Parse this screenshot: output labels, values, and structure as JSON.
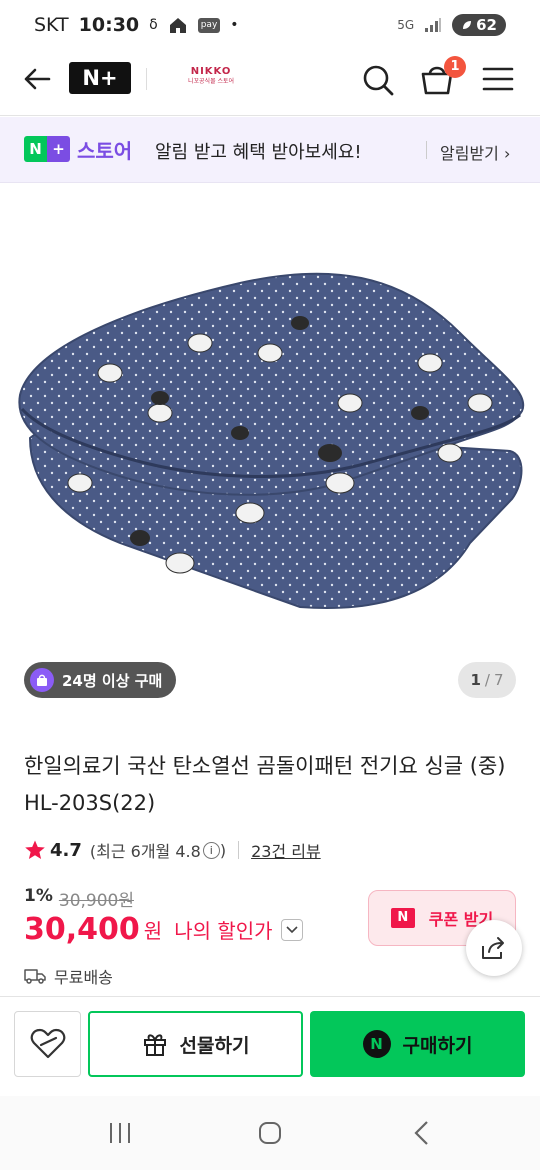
{
  "status_bar": {
    "carrier": "SKT",
    "time": "10:30",
    "pay_label": "pay",
    "network": "5G",
    "battery": "62"
  },
  "header": {
    "logo": "N+",
    "seller_logo_main": "NIKKO",
    "seller_logo_sub": "니꼬공식몰 스토어",
    "cart_count": "1"
  },
  "banner": {
    "logo_n": "N",
    "logo_plus": "+",
    "store_label": "스토어",
    "message": "알림 받고 혜택 받아보세요!",
    "action": "알림받기"
  },
  "gallery": {
    "purchase_badge": "24명 이상 구매",
    "page_current": "1",
    "page_sep": "/",
    "page_total": "7"
  },
  "product": {
    "title": "한일의료기 국산 탄소열선 곰돌이패턴 전기요 싱글 (중) HL-203S(22)",
    "rating": "4.7",
    "recent_rating": "(최근 6개월 4.8",
    "recent_rating_close": ")",
    "info_icon": "i",
    "review_count": "23건 리뷰",
    "discount_rate": "1%",
    "original_price": "30,900원",
    "sale_price": "30,400",
    "currency": "원",
    "my_price_label": "나의 할인가",
    "coupon_icon": "N",
    "coupon_label": "쿠폰 받기",
    "shipping": "무료배송"
  },
  "actions": {
    "gift_label": "선물하기",
    "buy_label": "구매하기",
    "buy_icon": "N"
  },
  "colors": {
    "naver_green": "#03c75a",
    "plus_purple": "#7b4de3",
    "price_red": "#f0174a",
    "blanket_navy": "#4a5a86"
  },
  "icons": {
    "back": "back-arrow-icon",
    "search": "search-icon",
    "cart": "cart-icon",
    "menu": "hamburger-menu-icon",
    "share": "share-icon",
    "wishlist": "heart-icon",
    "gift": "gift-icon",
    "truck": "truck-icon"
  }
}
